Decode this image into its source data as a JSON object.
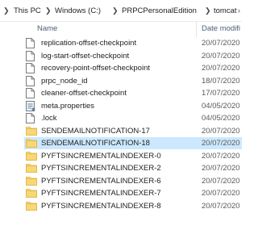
{
  "breadcrumb": {
    "items": [
      "This PC",
      "Windows (C:)",
      "PRPCPersonalEdition",
      "tomcat"
    ],
    "overflow_marker": "›"
  },
  "columns": {
    "name": "Name",
    "date": "Date modifi"
  },
  "files": [
    {
      "name": "replication-offset-checkpoint",
      "date": "20/07/2020",
      "type": "file",
      "selected": false
    },
    {
      "name": "log-start-offset-checkpoint",
      "date": "20/07/2020",
      "type": "file",
      "selected": false
    },
    {
      "name": "recovery-point-offset-checkpoint",
      "date": "20/07/2020",
      "type": "file",
      "selected": false
    },
    {
      "name": "prpc_node_id",
      "date": "18/07/2020",
      "type": "file",
      "selected": false
    },
    {
      "name": "cleaner-offset-checkpoint",
      "date": "17/07/2020",
      "type": "file",
      "selected": false
    },
    {
      "name": "meta.properties",
      "date": "04/05/2020",
      "type": "properties",
      "selected": false
    },
    {
      "name": ".lock",
      "date": "04/05/2020",
      "type": "file",
      "selected": false
    },
    {
      "name": "SENDEMAILNOTIFICATION-17",
      "date": "20/07/2020",
      "type": "folder",
      "selected": false
    },
    {
      "name": "SENDEMAILNOTIFICATION-18",
      "date": "20/07/2020",
      "type": "folder",
      "selected": true
    },
    {
      "name": "PYFTSINCREMENTALINDEXER-0",
      "date": "20/07/2020",
      "type": "folder",
      "selected": false
    },
    {
      "name": "PYFTSINCREMENTALINDEXER-2",
      "date": "20/07/2020",
      "type": "folder",
      "selected": false
    },
    {
      "name": "PYFTSINCREMENTALINDEXER-6",
      "date": "20/07/2020",
      "type": "folder",
      "selected": false
    },
    {
      "name": "PYFTSINCREMENTALINDEXER-7",
      "date": "20/07/2020",
      "type": "folder",
      "selected": false
    },
    {
      "name": "PYFTSINCREMENTALINDEXER-8",
      "date": "20/07/2020",
      "type": "folder",
      "selected": false
    }
  ],
  "colors": {
    "selection": "#cce8ff",
    "folder": "#f8d775",
    "header_text": "#4c607a"
  }
}
